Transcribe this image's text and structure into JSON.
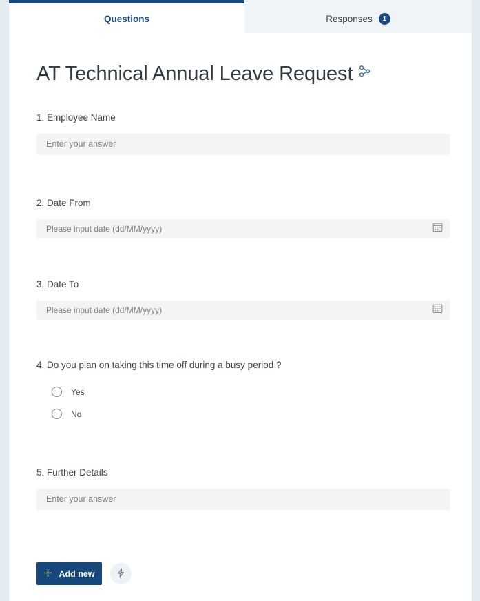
{
  "theme": {
    "accent": "#17487c",
    "page_background": "#e3eaf0",
    "sheet_background": "#ffffff",
    "input_background": "#f4f4f4",
    "inactive_tab_background": "#f0f4f7"
  },
  "tabs": [
    {
      "id": "questions",
      "label": "Questions",
      "active": true,
      "badge": null
    },
    {
      "id": "responses",
      "label": "Responses",
      "active": false,
      "badge": "1"
    }
  ],
  "form": {
    "title": "AT Technical Annual Leave Request",
    "branch_icon": "branch-icon",
    "questions": [
      {
        "number": "1.",
        "label": "1. Employee Name",
        "type": "text",
        "placeholder": "Enter your answer"
      },
      {
        "number": "2.",
        "label": "2. Date From",
        "type": "date",
        "placeholder": "Please input date (dd/MM/yyyy)",
        "icon": "calendar-icon"
      },
      {
        "number": "3.",
        "label": "3. Date To",
        "type": "date",
        "placeholder": "Please input date (dd/MM/yyyy)",
        "icon": "calendar-icon"
      },
      {
        "number": "4.",
        "label": "4. Do you plan on taking this time off during a busy period ?",
        "type": "choice",
        "options": [
          {
            "label": "Yes",
            "selected": false
          },
          {
            "label": "No",
            "selected": false
          }
        ]
      },
      {
        "number": "5.",
        "label": "5. Further Details",
        "type": "text",
        "placeholder": "Enter your answer"
      }
    ]
  },
  "footer": {
    "add_new_label": "Add new",
    "add_icon": "plus-icon",
    "ideas_icon": "lightning-bolt-icon"
  }
}
